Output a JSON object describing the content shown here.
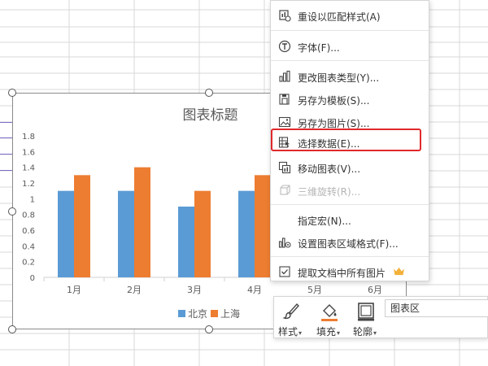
{
  "chart": {
    "title": "图表标题",
    "legend": [
      {
        "name": "北京",
        "color": "#5b9bd5"
      },
      {
        "name": "上海",
        "color": "#ed7d31"
      }
    ]
  },
  "chart_data": {
    "type": "bar",
    "title": "图表标题",
    "categories": [
      "1月",
      "2月",
      "3月",
      "4月",
      "5月",
      "6月"
    ],
    "series": [
      {
        "name": "北京",
        "values": [
          1.1,
          1.1,
          0.9,
          1.1,
          null,
          null
        ]
      },
      {
        "name": "上海",
        "values": [
          1.3,
          1.4,
          1.1,
          1.3,
          null,
          null
        ]
      }
    ],
    "ylim": [
      0,
      1.8
    ],
    "yticks": [
      "0",
      "0.2",
      "0.4",
      "0.6",
      "0.8",
      "1",
      "1.2",
      "1.4",
      "1.6",
      "1.8"
    ],
    "grid": false,
    "legend_position": "bottom",
    "colors": [
      "#5b9bd5",
      "#ed7d31"
    ]
  },
  "context_menu": {
    "items": [
      {
        "label": "重设以匹配样式(A)",
        "icon": "reset-style-icon",
        "disabled": false
      },
      {
        "label": "字体(F)...",
        "icon": "font-icon",
        "disabled": false
      },
      {
        "label": "更改图表类型(Y)...",
        "icon": "chart-type-icon",
        "disabled": false
      },
      {
        "label": "另存为模板(S)...",
        "icon": "save-template-icon",
        "disabled": false
      },
      {
        "label": "另存为图片(S)...",
        "icon": "save-image-icon",
        "disabled": false
      },
      {
        "label": "选择数据(E)...",
        "icon": "select-data-icon",
        "disabled": false
      },
      {
        "label": "移动图表(V)...",
        "icon": "move-chart-icon",
        "disabled": false
      },
      {
        "label": "三维旋转(R)...",
        "icon": "3d-rotate-icon",
        "disabled": true
      },
      {
        "label": "指定宏(N)...",
        "icon": "",
        "disabled": false
      },
      {
        "label": "设置图表区域格式(F)...",
        "icon": "format-area-icon",
        "disabled": false
      },
      {
        "label": "提取文档中所有图片",
        "icon": "extract-images-icon",
        "disabled": false
      }
    ]
  },
  "mini_toolbar": {
    "style_label": "样式",
    "fill_label": "填充",
    "outline_label": "轮廓",
    "area_value": "图表区"
  }
}
